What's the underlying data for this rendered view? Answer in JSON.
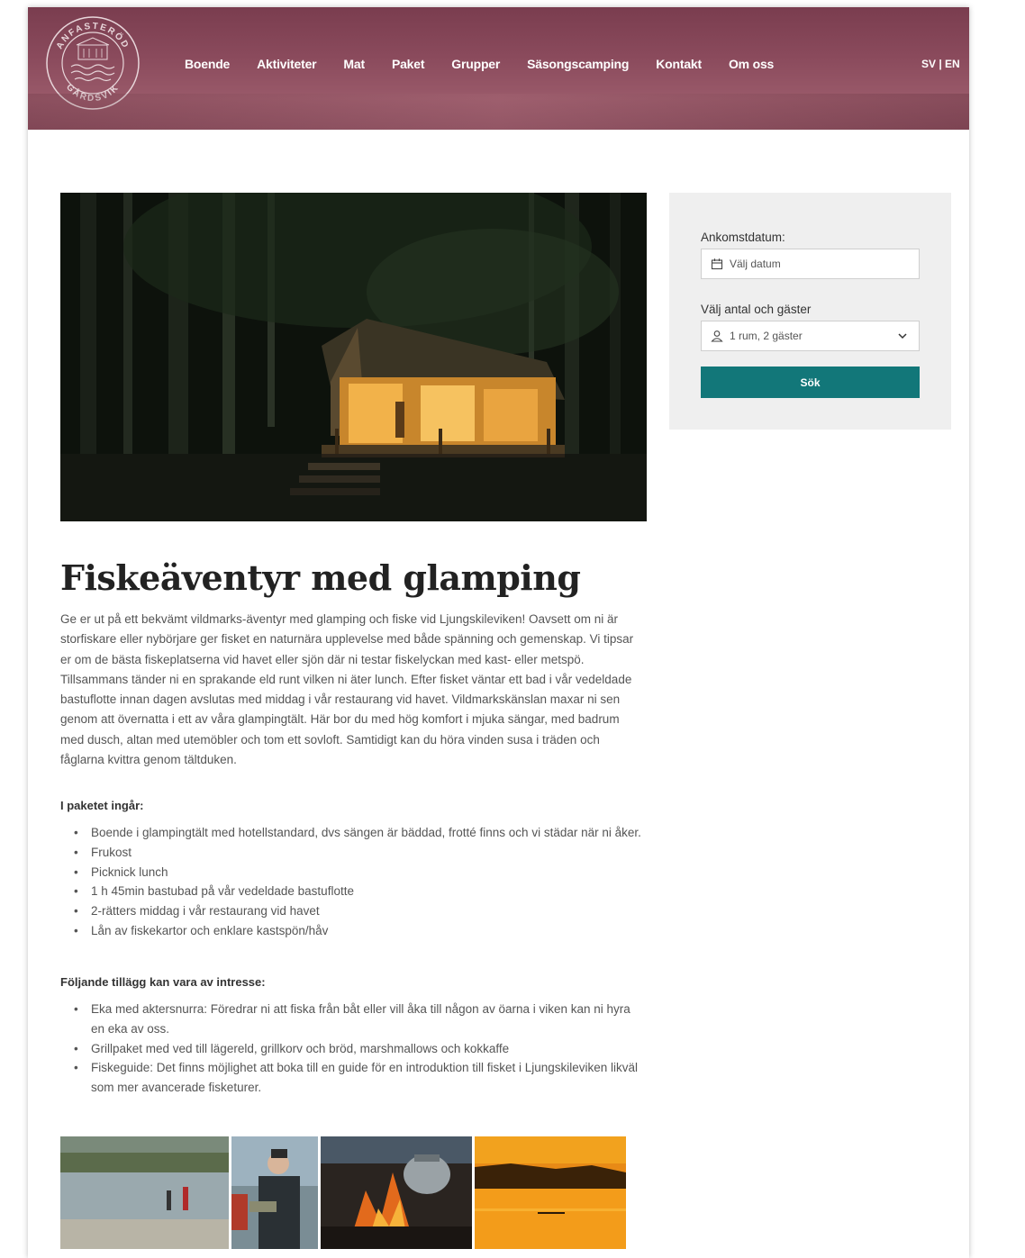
{
  "header": {
    "logo_text": [
      "ANFASTERÖD",
      "GÅRDSVIK"
    ],
    "nav": [
      "Boende",
      "Aktiviteter",
      "Mat",
      "Paket",
      "Grupper",
      "Säsongscamping",
      "Kontakt",
      "Om oss"
    ],
    "lang_sv": "SV",
    "lang_sep": " | ",
    "lang_en": "EN"
  },
  "booking": {
    "arrival_label": "Ankomstdatum:",
    "arrival_placeholder": "Välj datum",
    "guests_label": "Välj antal och gäster",
    "guests_value": "1 rum, 2 gäster",
    "search_button": "Sök"
  },
  "article": {
    "title": "Fiskeäventyr med glamping",
    "intro": "Ge er ut på ett bekvämt vildmarks-äventyr med glamping och fiske vid Ljungskileviken! Oavsett om ni är storfiskare eller nybörjare ger fisket en naturnära upplevelse med både spänning och gemenskap. Vi tipsar er om de bästa fiskeplatserna vid havet eller sjön där ni testar fiskelyckan med kast- eller metspö. Tillsammans tänder ni en sprakande eld runt vilken ni äter lunch. Efter fisket väntar ett bad i vår vedeldade bastuflotte innan dagen avslutas med middag i vår restaurang vid havet. Vildmarkskänslan maxar ni sen genom att övernatta i ett av våra glampingtält. Här bor du med hög komfort i mjuka sängar, med badrum med dusch, altan med utemöbler och tom ett sovloft. Samtidigt kan du höra vinden susa i träden och fåglarna kvittra genom tältduken.",
    "included_heading": "I paketet ingår:",
    "included": [
      "Boende i glampingtält med hotellstandard, dvs sängen är bäddad, frotté finns och vi städar när ni åker.",
      "Frukost",
      "Picknick lunch",
      "1 h 45min bastubad på vår vedeldade bastuflotte",
      "2-rätters middag i vår restaurang vid havet",
      "Lån av fiskekartor och enklare kastspön/håv"
    ],
    "addons_heading": "Följande tillägg kan vara av intresse:",
    "addons": [
      "Eka med aktersnurra: Föredrar ni att fiska från båt eller vill åka till någon av öarna i viken kan ni hyra en eka av oss.",
      "Grillpaket med ved till lägereld, grillkorv och bröd, marshmallows och kokkaffe",
      "Fiskeguide: Det finns möjlighet att boka till en guide för en introduktion till fisket i Ljungskileviken likväl som mer avancerade fisketurer."
    ]
  },
  "colors": {
    "header": "#8a4a5c",
    "accent": "#127779",
    "booking_bg": "#efefef"
  }
}
